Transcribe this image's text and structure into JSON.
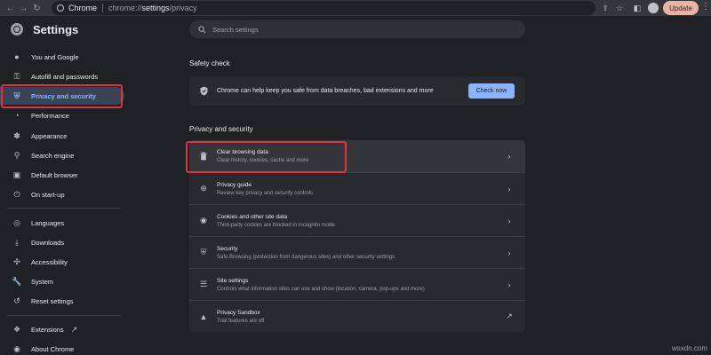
{
  "browser": {
    "site_label": "Chrome",
    "url_prefix": "chrome://",
    "url_bold": "settings",
    "url_suffix": "/privacy",
    "update_label": "Update"
  },
  "header": {
    "title": "Settings",
    "search_placeholder": "Search settings"
  },
  "sidebar": {
    "items": [
      {
        "label": "You and Google",
        "icon": "person-icon"
      },
      {
        "label": "Autofill and passwords",
        "icon": "key-icon"
      },
      {
        "label": "Privacy and security",
        "icon": "shield-icon",
        "active": true
      },
      {
        "label": "Performance",
        "icon": "speedometer-icon"
      },
      {
        "label": "Appearance",
        "icon": "palette-icon"
      },
      {
        "label": "Search engine",
        "icon": "search-icon"
      },
      {
        "label": "Default browser",
        "icon": "browser-icon"
      },
      {
        "label": "On start-up",
        "icon": "power-icon"
      },
      {
        "label": "Languages",
        "icon": "globe-icon"
      },
      {
        "label": "Downloads",
        "icon": "download-icon"
      },
      {
        "label": "Accessibility",
        "icon": "accessibility-icon"
      },
      {
        "label": "System",
        "icon": "wrench-icon"
      },
      {
        "label": "Reset settings",
        "icon": "reset-icon"
      },
      {
        "label": "Extensions",
        "icon": "puzzle-icon"
      },
      {
        "label": "About Chrome",
        "icon": "chrome-icon"
      }
    ]
  },
  "safety_check": {
    "heading": "Safety check",
    "text": "Chrome can help keep you safe from data breaches, bad extensions and more",
    "button": "Check now"
  },
  "privacy": {
    "heading": "Privacy and security",
    "rows": [
      {
        "title": "Clear browsing data",
        "subtitle": "Clear history, cookies, cache and more"
      },
      {
        "title": "Privacy guide",
        "subtitle": "Review key privacy and security controls"
      },
      {
        "title": "Cookies and other site data",
        "subtitle": "Third-party cookies are blocked in Incognito mode"
      },
      {
        "title": "Security",
        "subtitle": "Safe Browsing (protection from dangerous sites) and other security settings"
      },
      {
        "title": "Site settings",
        "subtitle": "Controls what information sites can use and show (location, camera, pop-ups and more)"
      },
      {
        "title": "Privacy Sandbox",
        "subtitle": "Trial features are off"
      }
    ]
  },
  "watermark": "wsxdn.com",
  "colors": {
    "accent": "#8ab4f8",
    "highlight": "#e8313f",
    "background": "#202124"
  }
}
